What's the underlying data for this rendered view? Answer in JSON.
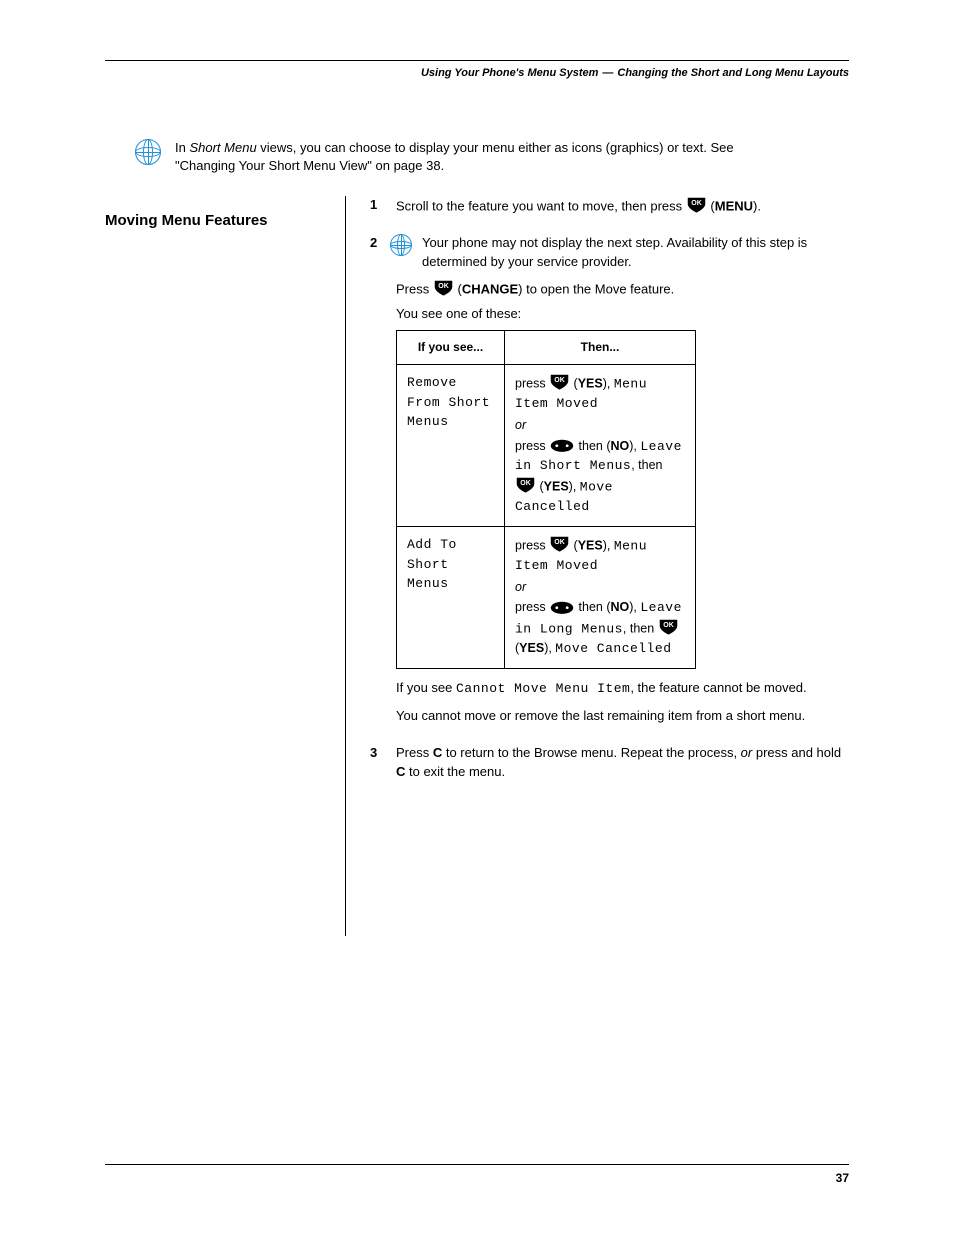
{
  "header": {
    "chapter": "Using Your Phone's Menu System",
    "section": "Changing the Short and Long Menu Layouts"
  },
  "intro_tip": {
    "text_before": "In ",
    "italic": "Short Menu",
    "text_after": " views, you can choose to display your menu either as icons (graphics) or text. See \"Changing Your Short Menu View\" on page 38."
  },
  "left": {
    "heading": "Moving Menu Features"
  },
  "steps": {
    "s1": {
      "prefix": "Scroll to the feature you want to move, then press ",
      "ok_label": "OK",
      "middle": " (",
      "button": "MENU",
      "suffix": ")."
    },
    "s2_tip": "Your phone may not display the next step. Availability of this step is determined by your service provider.",
    "s2": {
      "prefix": "Press ",
      "ok_label": "OK",
      "middle": " (",
      "button": "CHANGE",
      "suffix": ") to open the Move feature.",
      "text2": "You see one of these:"
    },
    "table": {
      "col1": "If you see...",
      "col2": "Then...",
      "row1": {
        "left": "Remove From Short Menus",
        "ok": "OK",
        "press_ok_prefix": "press ",
        "yes": "YES",
        "moved": "Menu Item Moved",
        "or": "or",
        "press_nav_prefix": "press ",
        "nav_then": " then ",
        "no": "NO",
        "leave": "Leave in Short Menus",
        "cancel": "Move Cancelled"
      },
      "row2": {
        "left": "Add To Short Menus",
        "ok": "OK",
        "press_ok_prefix": "press ",
        "yes": "YES",
        "moved": "Menu Item Moved",
        "or": "or",
        "press_nav_prefix": "press ",
        "nav_then": " then ",
        "no": "NO",
        "leave": "Leave in Long Menus",
        "comma": ",",
        "cancel": "Move Cancelled"
      }
    },
    "note1_prefix": "If you see ",
    "note1_lcd": "Cannot Move Menu Item",
    "note1_suffix": ", the feature cannot be moved.",
    "note2": "You cannot move or remove the last remaining item from a short menu.",
    "s3_prefix": "Press ",
    "s3_key": "C",
    "s3_mid": " to return to the Browse menu. Repeat the process, ",
    "s3_or": "or",
    "s3_suffix": " press and hold ",
    "s3_key2": "C",
    "s3_end": " to exit the menu."
  },
  "footer": {
    "page": "37"
  }
}
